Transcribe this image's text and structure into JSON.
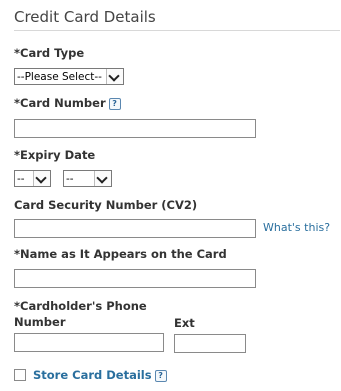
{
  "section": {
    "title": "Credit Card Details"
  },
  "card_type": {
    "label": "*Card Type",
    "selected": "--Please Select--"
  },
  "card_number": {
    "label": "*Card Number",
    "value": ""
  },
  "expiry": {
    "label": "*Expiry Date",
    "month_selected": "--",
    "year_selected": "--"
  },
  "cv2": {
    "label": "Card Security Number (CV2)",
    "value": "",
    "help_link": "What's this?"
  },
  "name_on_card": {
    "label": "*Name as It Appears on the Card",
    "value": ""
  },
  "phone": {
    "label_line1": "*Cardholder's Phone",
    "label_line2": "Number",
    "value": "",
    "ext_label": "Ext",
    "ext_value": ""
  },
  "store_card": {
    "label": "Store Card Details",
    "checked": false
  },
  "icons": {
    "help": "?"
  },
  "colors": {
    "link": "#2a6f9e",
    "text": "#333333",
    "rule": "#d8d8d8"
  }
}
